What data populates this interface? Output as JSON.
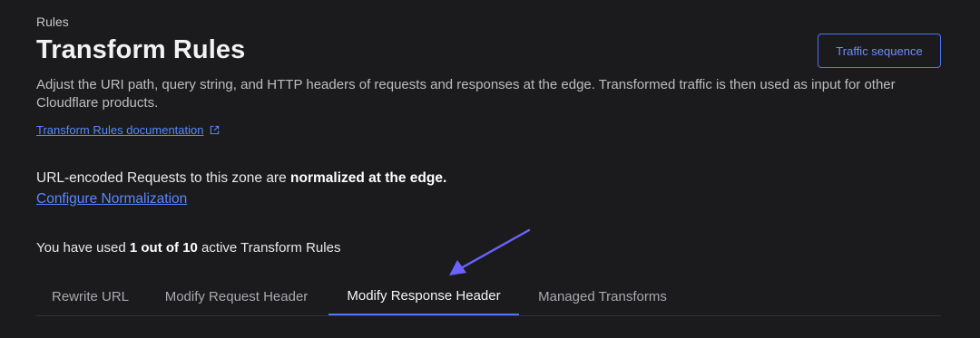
{
  "header": {
    "breadcrumb": "Rules",
    "title": "Transform Rules",
    "traffic_button": "Traffic sequence",
    "description": "Adjust the URI path, query string, and HTTP headers of requests and responses at the edge. Transformed traffic is then used as input for other Cloudflare products.",
    "doc_link": "Transform Rules documentation",
    "doc_link_icon": "external-link-icon"
  },
  "normalization": {
    "text_prefix": "URL-encoded Requests to this zone are ",
    "text_bold": "normalized at the edge.",
    "configure_link": "Configure Normalization"
  },
  "usage": {
    "prefix": "You have used ",
    "bold": "1 out of 10",
    "suffix": " active Transform Rules"
  },
  "tabs": [
    {
      "label": "Rewrite URL",
      "active": false
    },
    {
      "label": "Modify Request Header",
      "active": false
    },
    {
      "label": "Modify Response Header",
      "active": true
    },
    {
      "label": "Managed Transforms",
      "active": false
    }
  ],
  "colors": {
    "accent": "#4e73f5",
    "link": "#5b86ff",
    "annotation_arrow": "#6b63ff",
    "background": "#1b1b1d"
  }
}
